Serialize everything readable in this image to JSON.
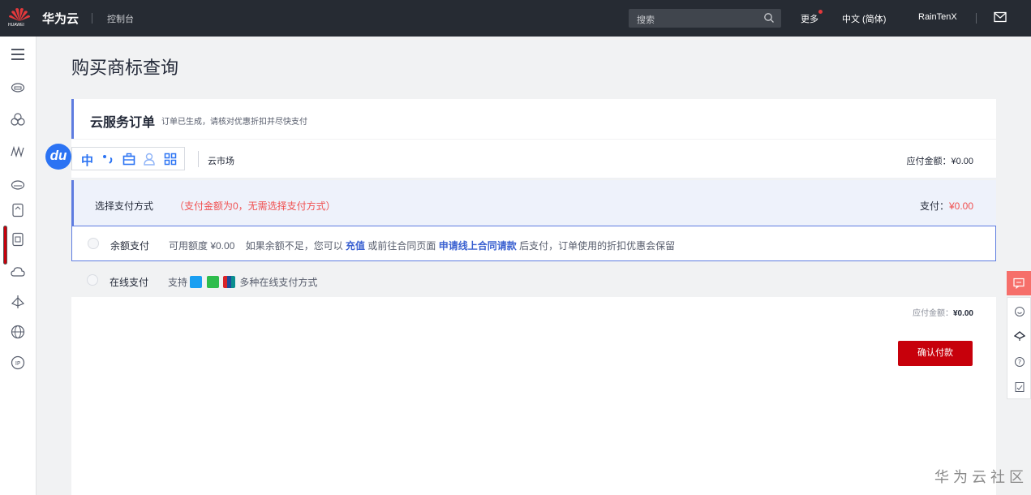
{
  "header": {
    "brand": "华为云",
    "logo_text": "HUAWEI",
    "console": "控制台",
    "search_placeholder": "搜索",
    "more": "更多",
    "language": "中文 (简体)",
    "username": "RainTenX"
  },
  "page": {
    "title": "购买商标查询"
  },
  "order": {
    "title": "云服务订单",
    "subtitle": "订单已生成，请核对优惠折扣并尽快支付",
    "market_name": "云市场",
    "market_amount": "应付金额：¥0.00"
  },
  "du_toolbar": {
    "badge": "du",
    "zh": "中"
  },
  "payment": {
    "heading": "选择支付方式",
    "notice": "（支付金额为0，无需选择支付方式）",
    "total_label": "支付：",
    "total_value": "¥0.00",
    "balance_label": "余额支付",
    "balance_desc_1": "可用额度 ¥0.00    如果余额不足，您可以 ",
    "balance_link_1": "充值",
    "balance_desc_2": " 或前往合同页面 ",
    "balance_link_2": "申请线上合同请款",
    "balance_desc_3": " 后支付，订单使用的折扣优惠会保留",
    "online_label": "在线支付",
    "online_desc_1": "支持 ",
    "online_desc_2": " 多种在线支付方式",
    "due_label": "应付金额：",
    "due_value": "¥0.00",
    "confirm": "确认付款"
  },
  "watermark": "华为云社区",
  "colors": {
    "topbar": "#262b33",
    "accent": "#5e7ce0",
    "danger": "#f05050",
    "primary_button": "#c7000b"
  }
}
